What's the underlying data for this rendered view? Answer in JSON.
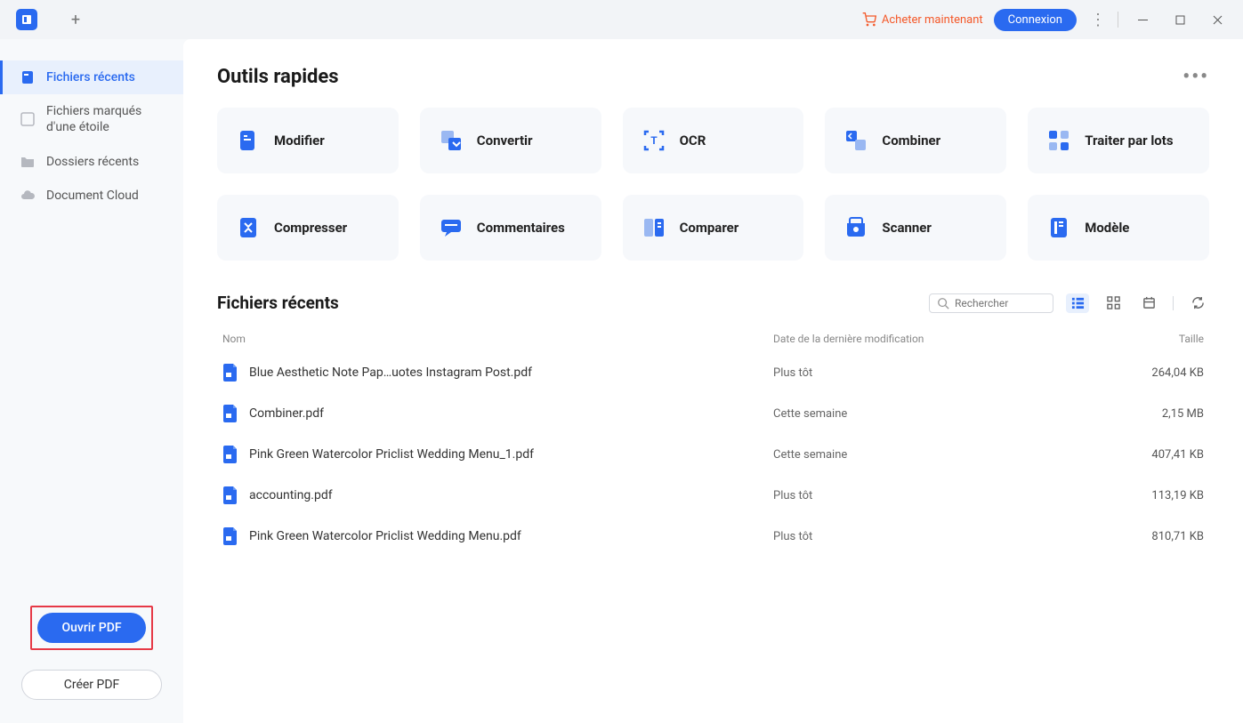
{
  "titlebar": {
    "buy_now": "Acheter maintenant",
    "login": "Connexion"
  },
  "sidebar": {
    "items": [
      {
        "label": "Fichiers récents"
      },
      {
        "label": "Fichiers marqués d'une étoile"
      },
      {
        "label": "Dossiers récents"
      },
      {
        "label": "Document Cloud"
      }
    ],
    "open_pdf": "Ouvrir PDF",
    "create_pdf": "Créer PDF"
  },
  "tools": {
    "title": "Outils rapides",
    "items": [
      {
        "label": "Modifier"
      },
      {
        "label": "Convertir"
      },
      {
        "label": "OCR"
      },
      {
        "label": "Combiner"
      },
      {
        "label": "Traiter par lots"
      },
      {
        "label": "Compresser"
      },
      {
        "label": "Commentaires"
      },
      {
        "label": "Comparer"
      },
      {
        "label": "Scanner"
      },
      {
        "label": "Modèle"
      }
    ]
  },
  "recent": {
    "title": "Fichiers récents",
    "search_placeholder": "Rechercher",
    "headers": {
      "name": "Nom",
      "date": "Date de la dernière modification",
      "size": "Taille"
    },
    "files": [
      {
        "name": "Blue Aesthetic Note Pap…uotes Instagram Post.pdf",
        "date": "Plus tôt",
        "size": "264,04 KB"
      },
      {
        "name": "Combiner.pdf",
        "date": "Cette semaine",
        "size": "2,15 MB"
      },
      {
        "name": "Pink Green Watercolor Priclist Wedding Menu_1.pdf",
        "date": "Cette semaine",
        "size": "407,41 KB"
      },
      {
        "name": "accounting.pdf",
        "date": "Plus tôt",
        "size": "113,19 KB"
      },
      {
        "name": "Pink Green Watercolor Priclist Wedding Menu.pdf",
        "date": "Plus tôt",
        "size": "810,71 KB"
      }
    ]
  }
}
